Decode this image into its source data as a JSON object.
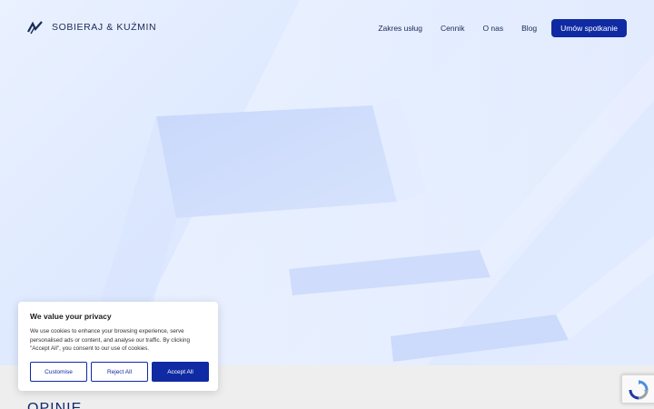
{
  "brand": {
    "name": "SOBIERAJ & KUŹMIN",
    "logo_icon": "zigzag-logo-icon"
  },
  "nav": {
    "items": [
      {
        "label": "Zakres usług"
      },
      {
        "label": "Cennik"
      },
      {
        "label": "O nas"
      },
      {
        "label": "Blog"
      }
    ],
    "cta_label": "Umów spotkanie"
  },
  "section": {
    "title": "OPINIE"
  },
  "cookie": {
    "title": "We value your privacy",
    "text": "We use cookies to enhance your browsing experience, serve personalised ads or content, and analyse our traffic. By clicking \"Accept All\", you consent to our use of cookies.",
    "buttons": {
      "customise": "Customise",
      "reject": "Reject All",
      "accept": "Accept All"
    }
  },
  "recaptcha": {
    "icon": "recaptcha-icon"
  },
  "colors": {
    "primary": "#0f2aa3",
    "text": "#1a2a55",
    "hero_bg": "#dce8ff",
    "section_bg": "#eeeeee"
  }
}
